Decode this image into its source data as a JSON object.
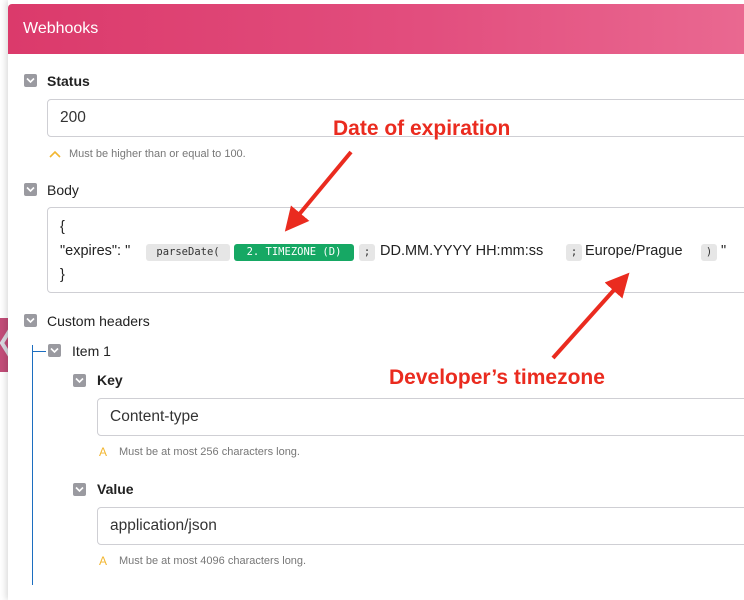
{
  "header": {
    "title": "Webhooks"
  },
  "status": {
    "label": "Status",
    "value": "200",
    "hint": "Must be higher than or equal to 100."
  },
  "body": {
    "label": "Body",
    "line1": "{",
    "line2_prefix": "\"expires\": \"",
    "parse_fn": "parseDate(",
    "timezone_token": "2. TIMEZONE (D)",
    "sep": ";",
    "format": "DD.MM.YYYY HH:mm:ss",
    "tz": "Europe/Prague",
    "close_paren": ")",
    "line2_suffix": "\"",
    "line3": "}"
  },
  "custom_headers": {
    "label": "Custom headers",
    "item_label": "Item 1",
    "key": {
      "label": "Key",
      "value": "Content-type",
      "hint": "Must be at most 256 characters long."
    },
    "value": {
      "label": "Value",
      "value": "application/json",
      "hint": "Must be at most 4096 characters long."
    }
  },
  "annotations": {
    "date_of_expiration": "Date of expiration",
    "developer_timezone": "Developer’s timezone",
    "color": "#ea2b1f"
  },
  "colors": {
    "header": "#e24e7e",
    "token_green": "#16a864",
    "tree_line": "#1c6ec0"
  }
}
